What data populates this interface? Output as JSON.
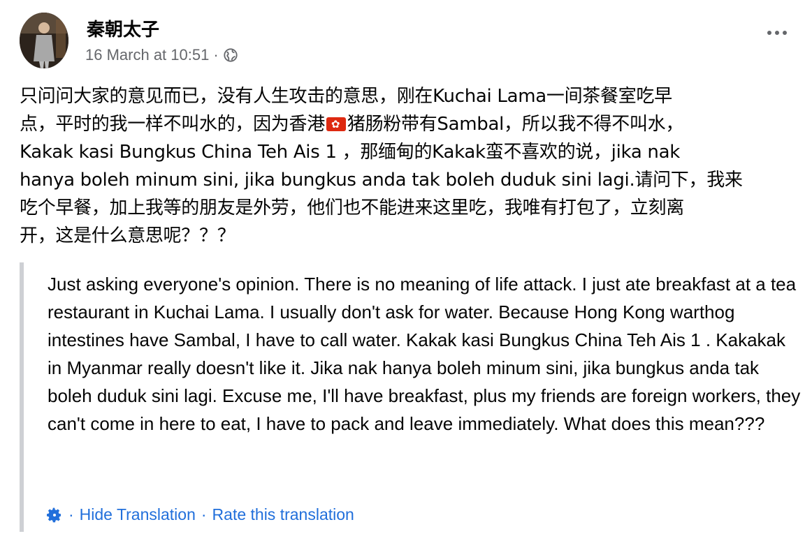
{
  "author": {
    "name": "秦朝太子"
  },
  "meta": {
    "timestamp": "16 March at 10:51",
    "separator": "·",
    "privacy_icon": "globe-icon"
  },
  "post": {
    "text_before_flag": "只问问大家的意见而已，没有人生攻击的意思，刚在Kuchai Lama一间茶餐室吃早\n点，平时的我一样不叫水的，因为香港",
    "flag_icon": "hong-kong-flag-icon",
    "text_after_flag": "猪肠粉带有Sambal，所以我不得不叫水，\nKakak kasi Bungkus China Teh Ais 1 ，那缅甸的Kakak蛮不喜欢的说，jika nak\nhanya boleh minum sini, jika bungkus anda tak boleh duduk sini lagi.请问下，我来\n吃个早餐，加上我等的朋友是外劳，他们也不能进来这里吃，我唯有打包了，立刻离\n开，这是什么意思呢？？？"
  },
  "translation": {
    "text": "Just asking everyone's opinion. There is no meaning of life attack. I just ate breakfast at a tea restaurant in Kuchai Lama. I usually don't ask for water. Because Hong Kong warthog intestines have Sambal, I have to call water. Kakak kasi Bungkus China Teh Ais 1 . Kakakak in Myanmar really doesn't like it. Jika nak hanya boleh minum sini, jika bungkus anda tak boleh duduk sini lagi. Excuse me, I'll have breakfast, plus my friends are foreign workers, they can't come in here to eat, I have to pack and leave immediately. What does this mean???",
    "settings_icon": "gear-icon",
    "sep1": "·",
    "hide_label": "Hide Translation",
    "sep2": "·",
    "rate_label": "Rate this translation"
  },
  "colors": {
    "text": "#050505",
    "secondary": "#65676b",
    "link": "#216fdb",
    "quote_bar": "#ced0d4"
  }
}
